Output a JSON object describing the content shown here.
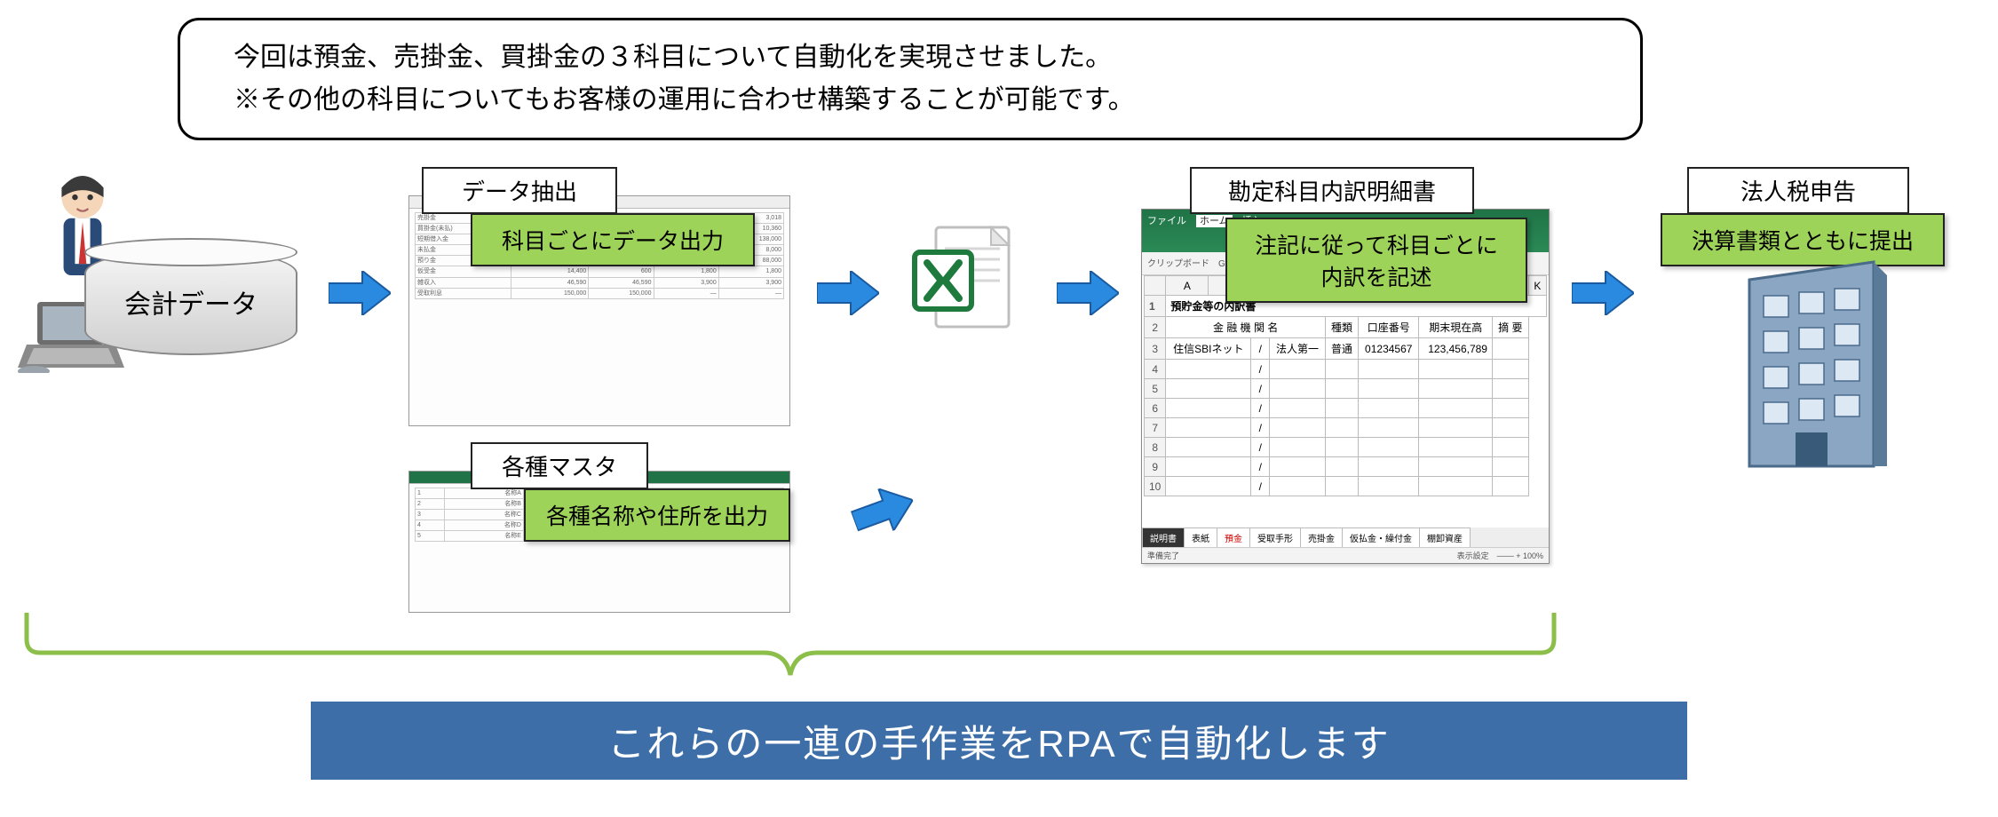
{
  "description": {
    "line1": "今回は預金、売掛金、買掛金の３科目について自動化を実現させました。",
    "line2": "※その他の科目についてもお客様の運用に合わせ構築することが可能です。"
  },
  "source": {
    "cylinder_label": "会計データ"
  },
  "extract": {
    "title": "データ抽出",
    "action": "科目ごとにデータ出力"
  },
  "master": {
    "title": "各種マスタ",
    "action": "各種名称や住所を出力"
  },
  "breakdown": {
    "title": "勘定科目内訳明細書",
    "action_line1": "注記に従って科目ごとに",
    "action_line2": "内訳を記述",
    "sheet_title": "預貯金等の内訳書",
    "columns": {
      "institution": "金 融 機 関 名",
      "type": "種類",
      "account_no": "口座番号",
      "balance": "期末現在高",
      "remarks": "摘 要"
    },
    "row": {
      "institution": "住信SBIネット",
      "branch": "法人第一",
      "type": "普通",
      "account_no": "01234567",
      "balance": "123,456,789"
    },
    "tabs": [
      "説明書",
      "表紙",
      "預金",
      "受取手形",
      "売掛金",
      "仮払金・繰付金",
      "棚卸資産"
    ],
    "status_left": "準備完了",
    "status_right_label": "表示設定",
    "status_zoom": "100%"
  },
  "tax": {
    "title": "法人税申告",
    "action": "決算書類とともに提出"
  },
  "footer": "これらの一連の手作業をRPAで自動化します"
}
